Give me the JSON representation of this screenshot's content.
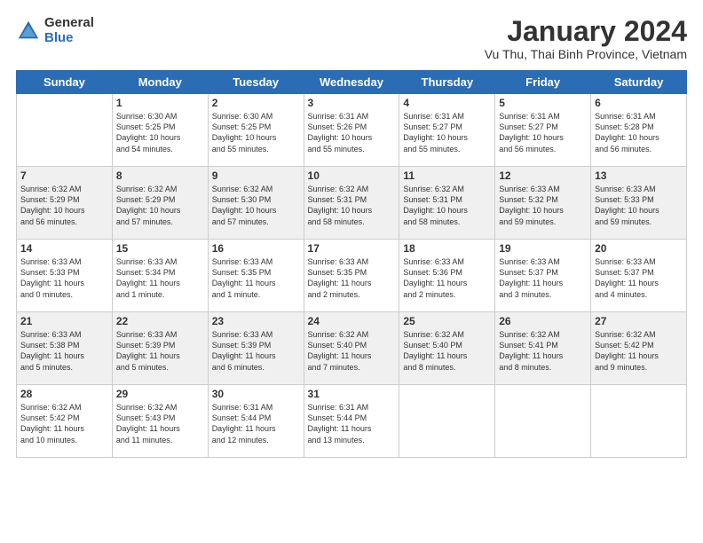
{
  "logo": {
    "general": "General",
    "blue": "Blue"
  },
  "header": {
    "month": "January 2024",
    "location": "Vu Thu, Thai Binh Province, Vietnam"
  },
  "weekdays": [
    "Sunday",
    "Monday",
    "Tuesday",
    "Wednesday",
    "Thursday",
    "Friday",
    "Saturday"
  ],
  "weeks": [
    [
      {
        "day": "",
        "info": ""
      },
      {
        "day": "1",
        "info": "Sunrise: 6:30 AM\nSunset: 5:25 PM\nDaylight: 10 hours\nand 54 minutes."
      },
      {
        "day": "2",
        "info": "Sunrise: 6:30 AM\nSunset: 5:25 PM\nDaylight: 10 hours\nand 55 minutes."
      },
      {
        "day": "3",
        "info": "Sunrise: 6:31 AM\nSunset: 5:26 PM\nDaylight: 10 hours\nand 55 minutes."
      },
      {
        "day": "4",
        "info": "Sunrise: 6:31 AM\nSunset: 5:27 PM\nDaylight: 10 hours\nand 55 minutes."
      },
      {
        "day": "5",
        "info": "Sunrise: 6:31 AM\nSunset: 5:27 PM\nDaylight: 10 hours\nand 56 minutes."
      },
      {
        "day": "6",
        "info": "Sunrise: 6:31 AM\nSunset: 5:28 PM\nDaylight: 10 hours\nand 56 minutes."
      }
    ],
    [
      {
        "day": "7",
        "info": "Sunrise: 6:32 AM\nSunset: 5:29 PM\nDaylight: 10 hours\nand 56 minutes."
      },
      {
        "day": "8",
        "info": "Sunrise: 6:32 AM\nSunset: 5:29 PM\nDaylight: 10 hours\nand 57 minutes."
      },
      {
        "day": "9",
        "info": "Sunrise: 6:32 AM\nSunset: 5:30 PM\nDaylight: 10 hours\nand 57 minutes."
      },
      {
        "day": "10",
        "info": "Sunrise: 6:32 AM\nSunset: 5:31 PM\nDaylight: 10 hours\nand 58 minutes."
      },
      {
        "day": "11",
        "info": "Sunrise: 6:32 AM\nSunset: 5:31 PM\nDaylight: 10 hours\nand 58 minutes."
      },
      {
        "day": "12",
        "info": "Sunrise: 6:33 AM\nSunset: 5:32 PM\nDaylight: 10 hours\nand 59 minutes."
      },
      {
        "day": "13",
        "info": "Sunrise: 6:33 AM\nSunset: 5:33 PM\nDaylight: 10 hours\nand 59 minutes."
      }
    ],
    [
      {
        "day": "14",
        "info": "Sunrise: 6:33 AM\nSunset: 5:33 PM\nDaylight: 11 hours\nand 0 minutes."
      },
      {
        "day": "15",
        "info": "Sunrise: 6:33 AM\nSunset: 5:34 PM\nDaylight: 11 hours\nand 1 minute."
      },
      {
        "day": "16",
        "info": "Sunrise: 6:33 AM\nSunset: 5:35 PM\nDaylight: 11 hours\nand 1 minute."
      },
      {
        "day": "17",
        "info": "Sunrise: 6:33 AM\nSunset: 5:35 PM\nDaylight: 11 hours\nand 2 minutes."
      },
      {
        "day": "18",
        "info": "Sunrise: 6:33 AM\nSunset: 5:36 PM\nDaylight: 11 hours\nand 2 minutes."
      },
      {
        "day": "19",
        "info": "Sunrise: 6:33 AM\nSunset: 5:37 PM\nDaylight: 11 hours\nand 3 minutes."
      },
      {
        "day": "20",
        "info": "Sunrise: 6:33 AM\nSunset: 5:37 PM\nDaylight: 11 hours\nand 4 minutes."
      }
    ],
    [
      {
        "day": "21",
        "info": "Sunrise: 6:33 AM\nSunset: 5:38 PM\nDaylight: 11 hours\nand 5 minutes."
      },
      {
        "day": "22",
        "info": "Sunrise: 6:33 AM\nSunset: 5:39 PM\nDaylight: 11 hours\nand 5 minutes."
      },
      {
        "day": "23",
        "info": "Sunrise: 6:33 AM\nSunset: 5:39 PM\nDaylight: 11 hours\nand 6 minutes."
      },
      {
        "day": "24",
        "info": "Sunrise: 6:32 AM\nSunset: 5:40 PM\nDaylight: 11 hours\nand 7 minutes."
      },
      {
        "day": "25",
        "info": "Sunrise: 6:32 AM\nSunset: 5:40 PM\nDaylight: 11 hours\nand 8 minutes."
      },
      {
        "day": "26",
        "info": "Sunrise: 6:32 AM\nSunset: 5:41 PM\nDaylight: 11 hours\nand 8 minutes."
      },
      {
        "day": "27",
        "info": "Sunrise: 6:32 AM\nSunset: 5:42 PM\nDaylight: 11 hours\nand 9 minutes."
      }
    ],
    [
      {
        "day": "28",
        "info": "Sunrise: 6:32 AM\nSunset: 5:42 PM\nDaylight: 11 hours\nand 10 minutes."
      },
      {
        "day": "29",
        "info": "Sunrise: 6:32 AM\nSunset: 5:43 PM\nDaylight: 11 hours\nand 11 minutes."
      },
      {
        "day": "30",
        "info": "Sunrise: 6:31 AM\nSunset: 5:44 PM\nDaylight: 11 hours\nand 12 minutes."
      },
      {
        "day": "31",
        "info": "Sunrise: 6:31 AM\nSunset: 5:44 PM\nDaylight: 11 hours\nand 13 minutes."
      },
      {
        "day": "",
        "info": ""
      },
      {
        "day": "",
        "info": ""
      },
      {
        "day": "",
        "info": ""
      }
    ]
  ]
}
